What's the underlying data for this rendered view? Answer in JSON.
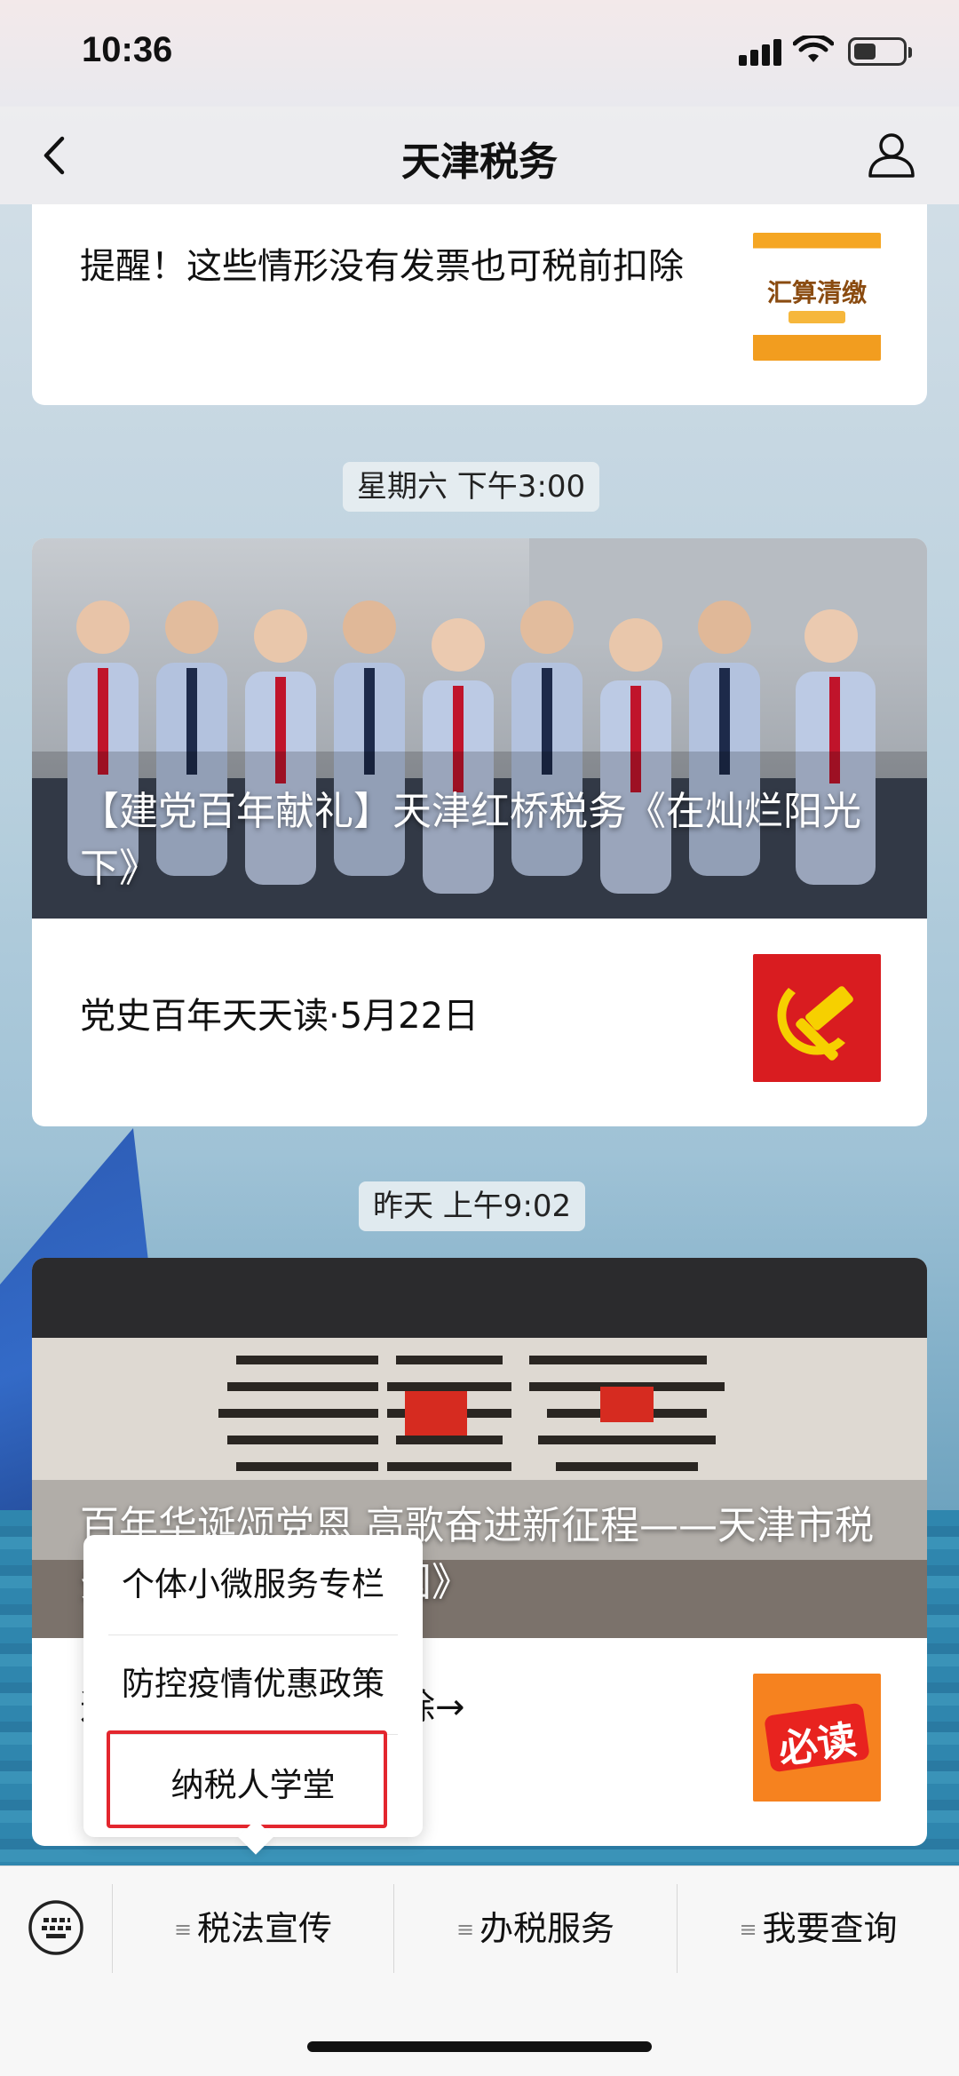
{
  "status_bar": {
    "time": "10:36"
  },
  "nav": {
    "title": "天津税务"
  },
  "article1": {
    "title": "提醒！这些情形没有发票也可税前扣除",
    "thumb_text": "汇算清缴"
  },
  "time_labels": {
    "t1": "星期六 下午3:00",
    "t2": "昨天 上午9:02"
  },
  "feature1": {
    "cover_title": "【建党百年献礼】天津红桥税务《在灿烂阳光下》",
    "item_title": "党史百年天天读·5月22日"
  },
  "feature2": {
    "cover_title": "百年华诞颂党恩 高歌奋进新征程——天津市税务局《灯火里的中国》",
    "item_title": "这些项目可以税前扣除→",
    "thumb_text": "必读"
  },
  "submenu": {
    "items": [
      "个体小微服务专栏",
      "防控疫情优惠政策",
      "纳税人学堂"
    ]
  },
  "bottom_menu": {
    "items": [
      "税法宣传",
      "办税服务",
      "我要查询"
    ]
  },
  "colors": {
    "highlight": "#e3262e",
    "party_red": "#d91c20",
    "party_gold": "#f6d000"
  }
}
